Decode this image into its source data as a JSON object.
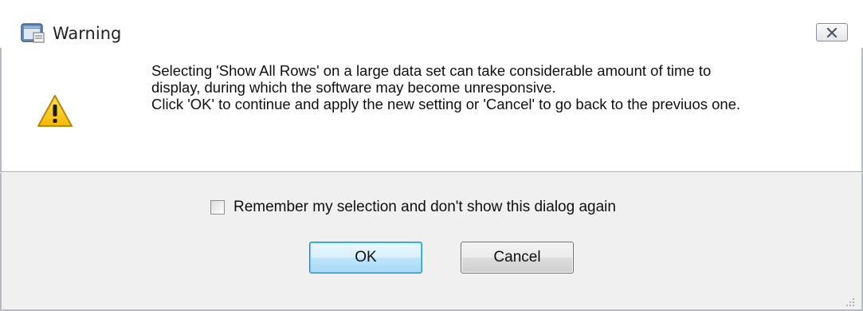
{
  "window": {
    "title": "Warning",
    "app_icon": "window-app-icon",
    "close_icon": "close-icon"
  },
  "message": {
    "icon": "warning-icon",
    "lines": [
      "Selecting 'Show All Rows' on a large data set can take considerable amount of time to",
      "display, during which the software may become unresponsive.",
      "Click 'OK' to continue and apply the new setting or 'Cancel' to go back to the previuos one."
    ]
  },
  "remember_checkbox": {
    "label": "Remember my selection and don't show this dialog again",
    "checked": false
  },
  "buttons": {
    "ok_label": "OK",
    "cancel_label": "Cancel"
  },
  "colors": {
    "warning_yellow": "#f5c400",
    "default_button_border": "#3c7fb1"
  }
}
